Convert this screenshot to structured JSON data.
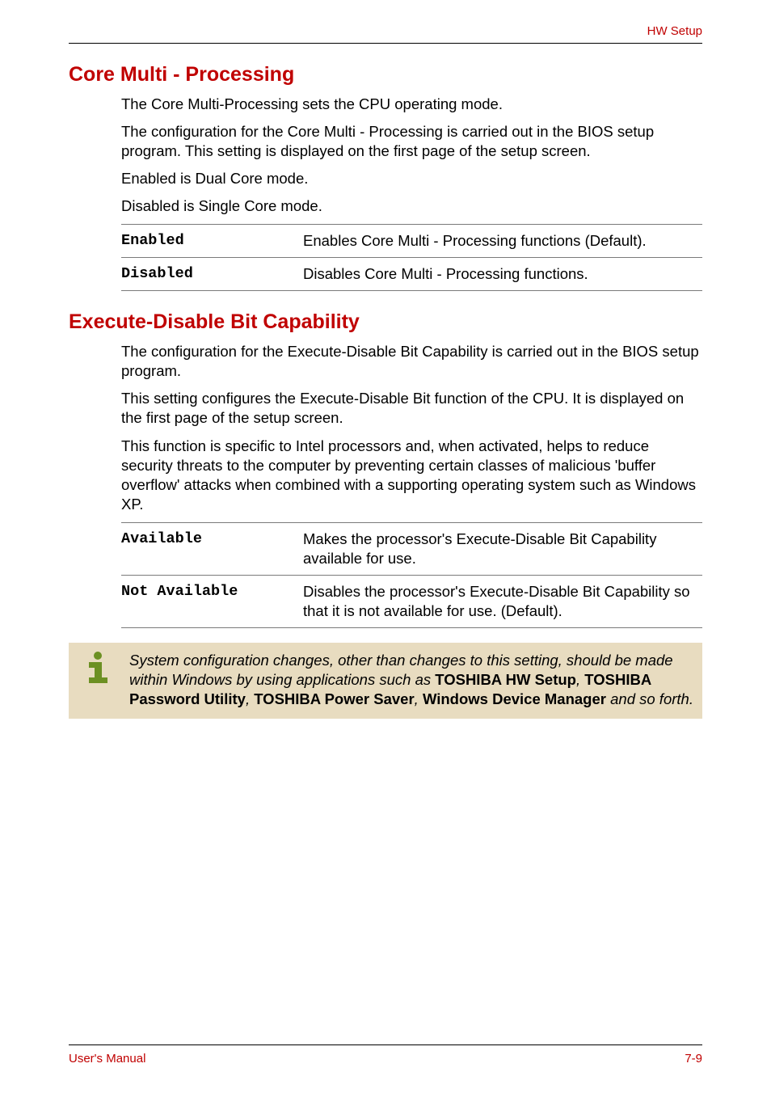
{
  "header": {
    "right": "HW Setup"
  },
  "section1": {
    "title": "Core Multi - Processing",
    "p1": "The Core Multi-Processing sets the CPU operating mode.",
    "p2": "The configuration for the Core Multi - Processing is carried out in the BIOS setup program. This setting is displayed on the first page of the setup screen.",
    "p3": "Enabled is Dual Core mode.",
    "p4": "Disabled is Single Core mode.",
    "options": [
      {
        "name": "Enabled",
        "desc": "Enables Core Multi - Processing functions (Default)."
      },
      {
        "name": "Disabled",
        "desc": "Disables Core Multi - Processing functions."
      }
    ]
  },
  "section2": {
    "title": "Execute-Disable Bit Capability",
    "p1": "The configuration for the Execute-Disable Bit Capability is carried out in the BIOS setup program.",
    "p2": "This setting configures the Execute-Disable Bit function of the CPU. It is displayed on the first page of the setup screen.",
    "p3": "This function is specific to Intel processors and, when activated, helps to reduce security threats to the computer by preventing certain classes of malicious 'buffer overflow' attacks when combined with a supporting operating system such as Windows XP.",
    "options": [
      {
        "name": "Available",
        "desc": "Makes the processor's Execute-Disable Bit Capability available for use."
      },
      {
        "name": "Not Available",
        "desc": "Disables the processor's Execute-Disable Bit Capability so that it is not available for use. (Default)."
      }
    ]
  },
  "note": {
    "pre": "System configuration changes, other than changes to this setting, should be made within Windows by using applications such as ",
    "b1": "TOSHIBA HW Setup",
    "c1": ", ",
    "b2": "TOSHIBA Password Utility",
    "c2": ", ",
    "b3": "TOSHIBA Power Saver",
    "c3": ", ",
    "b4": "Windows Device Manager",
    "post": " and so forth."
  },
  "footer": {
    "left": "User's Manual",
    "right": "7-9"
  }
}
